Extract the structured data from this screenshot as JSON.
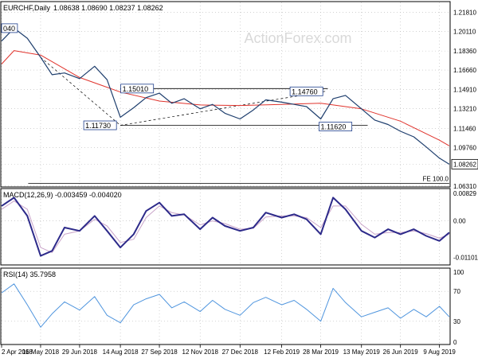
{
  "header": {
    "symbol": "EURCHF",
    "timeframe": "Daily",
    "ohlc": "1.08638 1.08690 1.08237 1.08262",
    "watermark": "ActionForex.com"
  },
  "colors": {
    "background": "#ffffff",
    "price": "#1f3f6e",
    "sma": "#e0332c",
    "macd": "#2d2a8a",
    "signal": "#c9a4c9",
    "rsi": "#4f95de",
    "trendlines": "#000000",
    "grid": "#b8b8b8",
    "watermark": "#d9d9d9",
    "label_border": "#1f3f8c"
  },
  "chart_data": [
    {
      "type": "line",
      "panel": "price",
      "title": "EURCHF,Daily",
      "subtitle": "1.08638 1.08690 1.08237 1.08262",
      "ylim": [
        1.063,
        1.227
      ],
      "y_ticks": [
        "1.21810",
        "1.20110",
        "1.18360",
        "1.16660",
        "1.14910",
        "1.13210",
        "1.11460",
        "1.09760",
        "1.08262",
        "1.06310"
      ],
      "last_value_label": "1.08262",
      "x_ticks": [
        "2 Apr 2018",
        "16 May 2018",
        "29 Jun 2018",
        "14 Aug 2018",
        "27 Sep 2018",
        "12 Nov 2018",
        "27 Dec 2018",
        "12 Feb 2019",
        "28 Mar 2019",
        "13 May 2019",
        "26 Jun 2019",
        "9 Aug 2019"
      ],
      "series": [
        {
          "x": [
            "2 Apr 2018",
            "16 Apr 2018",
            "1 May 2018",
            "16 May 2018",
            "29 May 2018",
            "12 Jun 2018",
            "29 Jun 2018",
            "16 Jul 2018",
            "30 Jul 2018",
            "14 Aug 2018",
            "29 Aug 2018",
            "12 Sep 2018",
            "27 Sep 2018",
            "11 Oct 2018",
            "25 Oct 2018",
            "12 Nov 2018",
            "26 Nov 2018",
            "10 Dec 2018",
            "27 Dec 2018",
            "11 Jan 2019",
            "25 Jan 2019",
            "12 Feb 2019",
            "26 Feb 2019",
            "12 Mar 2019",
            "28 Mar 2019",
            "11 Apr 2019",
            "25 Apr 2019",
            "13 May 2019",
            "28 May 2019",
            "12 Jun 2019",
            "26 Jun 2019",
            "11 Jul 2019",
            "25 Jul 2019",
            "9 Aug 2019",
            "20 Aug 2019"
          ],
          "values": [
            1.1925,
            1.204,
            1.195,
            1.178,
            1.1625,
            1.164,
            1.159,
            1.17,
            1.158,
            1.1245,
            1.133,
            1.142,
            1.146,
            1.137,
            1.141,
            1.132,
            1.136,
            1.128,
            1.123,
            1.131,
            1.14,
            1.138,
            1.136,
            1.134,
            1.123,
            1.141,
            1.144,
            1.132,
            1.122,
            1.118,
            1.112,
            1.107,
            1.098,
            1.088,
            1.0826
          ]
        },
        {
          "x": [
            "2 Apr 2018",
            "16 Apr 2018",
            "16 May 2018",
            "29 Jun 2018",
            "14 Aug 2018",
            "27 Sep 2018",
            "12 Nov 2018",
            "27 Dec 2018",
            "12 Feb 2019",
            "28 Mar 2019",
            "13 May 2019",
            "26 Jun 2019",
            "9 Aug 2019",
            "20 Aug 2019"
          ],
          "values": [
            1.172,
            1.184,
            1.18,
            1.16,
            1.147,
            1.139,
            1.1355,
            1.135,
            1.136,
            1.137,
            1.132,
            1.121,
            1.104,
            1.099
          ]
        }
      ],
      "annotations": [
        {
          "text": "1.15010",
          "x": "23 Sep 2018",
          "y": 1.1501
        },
        {
          "text": "1.14760",
          "x": "2 Apr 2019",
          "y": 1.1476
        },
        {
          "text": "1.11730",
          "x": "14 Aug 2018",
          "y": 1.1173
        },
        {
          "text": "1.11620",
          "x": "28 Mar 2019",
          "y": 1.1162
        },
        {
          "text": "040",
          "x": "2 Apr 2018",
          "y": 1.204
        },
        {
          "text": "FE 100.0",
          "x": "20 Aug 2019",
          "y": 1.0655
        }
      ]
    },
    {
      "type": "line",
      "panel": "macd",
      "title": "MACD(12,26,9) -0.003459 -0.004020",
      "ylim": [
        -0.013,
        0.0095
      ],
      "y_ticks": [
        "0.00829",
        "0.00",
        "-0.011015"
      ],
      "series": [
        {
          "x": [
            "2 Apr 2018",
            "16 Apr 2018",
            "1 May 2018",
            "16 May 2018",
            "29 May 2018",
            "12 Jun 2018",
            "29 Jun 2018",
            "16 Jul 2018",
            "30 Jul 2018",
            "14 Aug 2018",
            "29 Aug 2018",
            "12 Sep 2018",
            "27 Sep 2018",
            "11 Oct 2018",
            "25 Oct 2018",
            "12 Nov 2018",
            "26 Nov 2018",
            "10 Dec 2018",
            "27 Dec 2018",
            "11 Jan 2019",
            "25 Jan 2019",
            "12 Feb 2019",
            "26 Feb 2019",
            "12 Mar 2019",
            "28 Mar 2019",
            "11 Apr 2019",
            "25 Apr 2019",
            "13 May 2019",
            "28 May 2019",
            "12 Jun 2019",
            "26 Jun 2019",
            "11 Jul 2019",
            "25 Jul 2019",
            "9 Aug 2019",
            "20 Aug 2019"
          ],
          "values": [
            0.0045,
            0.007,
            0.0015,
            -0.0105,
            -0.009,
            -0.002,
            -0.003,
            0.0015,
            -0.003,
            -0.008,
            -0.004,
            0.003,
            0.0055,
            0.0015,
            0.002,
            -0.0025,
            0.001,
            -0.0015,
            -0.003,
            -0.002,
            0.0025,
            0.001,
            0.002,
            0.0005,
            -0.004,
            0.007,
            0.0035,
            -0.003,
            -0.005,
            -0.0025,
            -0.004,
            -0.0025,
            -0.0045,
            -0.006,
            -0.0035
          ]
        },
        {
          "x": [
            "2 Apr 2018",
            "16 Apr 2018",
            "1 May 2018",
            "16 May 2018",
            "29 May 2018",
            "12 Jun 2018",
            "29 Jun 2018",
            "16 Jul 2018",
            "30 Jul 2018",
            "14 Aug 2018",
            "29 Aug 2018",
            "12 Sep 2018",
            "27 Sep 2018",
            "11 Oct 2018",
            "25 Oct 2018",
            "12 Nov 2018",
            "26 Nov 2018",
            "10 Dec 2018",
            "27 Dec 2018",
            "11 Jan 2019",
            "25 Jan 2019",
            "12 Feb 2019",
            "26 Feb 2019",
            "12 Mar 2019",
            "28 Mar 2019",
            "11 Apr 2019",
            "25 Apr 2019",
            "13 May 2019",
            "28 May 2019",
            "12 Jun 2019",
            "26 Jun 2019",
            "11 Jul 2019",
            "25 Jul 2019",
            "9 Aug 2019",
            "20 Aug 2019"
          ],
          "values": [
            0.0035,
            0.006,
            0.0035,
            -0.008,
            -0.0095,
            -0.004,
            -0.003,
            0.0005,
            -0.0015,
            -0.0065,
            -0.0055,
            0.001,
            0.0045,
            0.0025,
            0.0018,
            -0.0012,
            0.0,
            -0.0008,
            -0.0025,
            -0.0022,
            0.0012,
            0.0015,
            0.0015,
            0.001,
            -0.002,
            0.0045,
            0.0045,
            -0.001,
            -0.004,
            -0.0035,
            -0.0035,
            -0.003,
            -0.0038,
            -0.0052,
            -0.004
          ]
        }
      ]
    },
    {
      "type": "line",
      "panel": "rsi",
      "title": "RSI(14) 35.7958",
      "ylim": [
        0,
        100
      ],
      "y_ticks": [
        "100",
        "70",
        "30",
        "0"
      ],
      "series": [
        {
          "x": [
            "2 Apr 2018",
            "16 Apr 2018",
            "1 May 2018",
            "16 May 2018",
            "29 May 2018",
            "12 Jun 2018",
            "29 Jun 2018",
            "16 Jul 2018",
            "30 Jul 2018",
            "14 Aug 2018",
            "29 Aug 2018",
            "12 Sep 2018",
            "27 Sep 2018",
            "11 Oct 2018",
            "25 Oct 2018",
            "12 Nov 2018",
            "26 Nov 2018",
            "10 Dec 2018",
            "27 Dec 2018",
            "11 Jan 2019",
            "25 Jan 2019",
            "12 Feb 2019",
            "26 Feb 2019",
            "12 Mar 2019",
            "28 Mar 2019",
            "11 Apr 2019",
            "25 Apr 2019",
            "13 May 2019",
            "28 May 2019",
            "12 Jun 2019",
            "26 Jun 2019",
            "11 Jul 2019",
            "25 Jul 2019",
            "9 Aug 2019",
            "20 Aug 2019"
          ],
          "values": [
            68,
            80,
            52,
            22,
            40,
            56,
            45,
            63,
            38,
            28,
            52,
            60,
            66,
            48,
            56,
            43,
            58,
            46,
            38,
            55,
            62,
            52,
            58,
            46,
            30,
            74,
            55,
            36,
            42,
            48,
            34,
            46,
            36,
            50,
            36
          ]
        }
      ]
    }
  ]
}
